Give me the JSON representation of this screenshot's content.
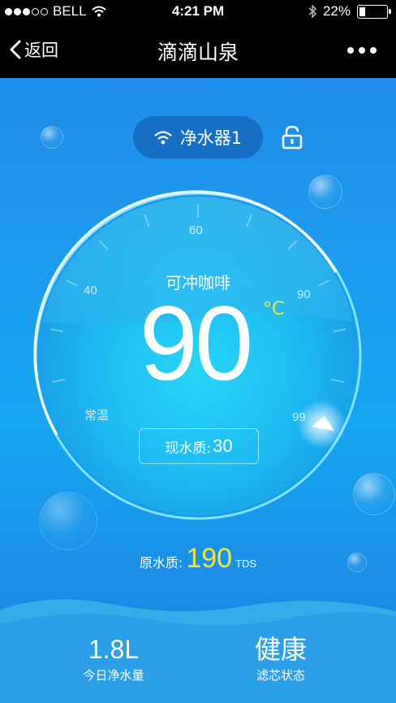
{
  "status_bar": {
    "carrier": "BELL",
    "time": "4:21 PM",
    "battery": "22%",
    "battery_level": 0.22
  },
  "nav": {
    "back_label": "返回",
    "title": "滴滴山泉"
  },
  "device": {
    "name": "净水器1"
  },
  "dial": {
    "ticks": [
      "常温",
      "40",
      "60",
      "90",
      "99"
    ],
    "mode": "可冲咖啡",
    "temperature": "90",
    "unit": "°C",
    "current_quality_label": "现水质:",
    "current_quality_value": "30"
  },
  "raw_water": {
    "label": "原水质:",
    "value": "190",
    "unit": "TDS"
  },
  "stats": [
    {
      "value": "1.8L",
      "label": "今日净水量"
    },
    {
      "value": "健康",
      "label": "滤芯状态"
    }
  ],
  "colors": {
    "accent_yellow": "#f5e33a",
    "background_blue": "#1b95ec",
    "ring_cyan": "#7fe6ff"
  }
}
